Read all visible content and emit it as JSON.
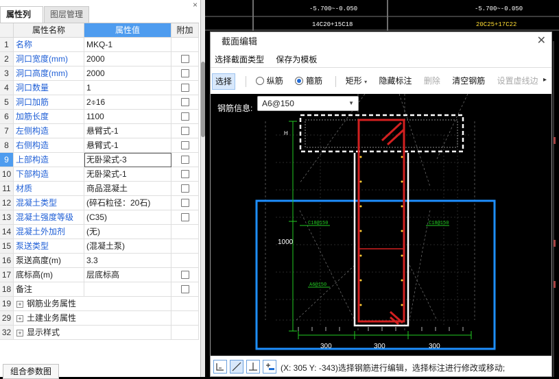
{
  "left_panel": {
    "tabs": [
      "属性列表",
      "图层管理"
    ],
    "close_glyph": "×",
    "headers": [
      "属性名称",
      "属性值",
      "附加"
    ],
    "rows": [
      {
        "num": "1",
        "name": "名称",
        "value": "MKQ-1",
        "name_color": "blue",
        "checkbox": false
      },
      {
        "num": "2",
        "name": "洞口宽度(mm)",
        "value": "2000",
        "name_color": "blue",
        "checkbox": true
      },
      {
        "num": "3",
        "name": "洞口高度(mm)",
        "value": "2000",
        "name_color": "blue",
        "checkbox": true
      },
      {
        "num": "4",
        "name": "洞口数量",
        "value": "1",
        "name_color": "blue",
        "checkbox": true
      },
      {
        "num": "5",
        "name": "洞口加筋",
        "value": "2⌽16",
        "name_color": "blue",
        "checkbox": true
      },
      {
        "num": "6",
        "name": "加筋长度",
        "value": "1100",
        "name_color": "blue",
        "checkbox": true
      },
      {
        "num": "7",
        "name": "左侧构造",
        "value": "悬臂式-1",
        "name_color": "blue",
        "checkbox": true
      },
      {
        "num": "8",
        "name": "右侧构造",
        "value": "悬臂式-1",
        "name_color": "blue",
        "checkbox": true
      },
      {
        "num": "9",
        "name": "上部构造",
        "value": "无卧梁式-3",
        "name_color": "blue",
        "checkbox": true,
        "selected": true
      },
      {
        "num": "10",
        "name": "下部构造",
        "value": "无卧梁式-1",
        "name_color": "blue",
        "checkbox": true
      },
      {
        "num": "11",
        "name": "材质",
        "value": "商品混凝土",
        "name_color": "blue",
        "checkbox": true
      },
      {
        "num": "12",
        "name": "混凝土类型",
        "value": "(碎石粒径：20石)",
        "name_color": "blue",
        "checkbox": true
      },
      {
        "num": "13",
        "name": "混凝土强度等级",
        "value": "(C35)",
        "name_color": "blue",
        "checkbox": true
      },
      {
        "num": "14",
        "name": "混凝土外加剂",
        "value": "(无)",
        "name_color": "blue",
        "checkbox": false
      },
      {
        "num": "15",
        "name": "泵送类型",
        "value": "(混凝土泵)",
        "name_color": "blue",
        "checkbox": false
      },
      {
        "num": "16",
        "name": "泵送高度(m)",
        "value": "3.3",
        "name_color": "black",
        "checkbox": false,
        "value_muted": true
      },
      {
        "num": "17",
        "name": "底标高(m)",
        "value": "层底标高",
        "name_color": "black",
        "checkbox": true
      },
      {
        "num": "18",
        "name": "备注",
        "value": "",
        "name_color": "black",
        "checkbox": true
      }
    ],
    "groups": [
      {
        "num": "19",
        "label": "钢筋业务属性"
      },
      {
        "num": "29",
        "label": "土建业务属性"
      },
      {
        "num": "32",
        "label": "显示样式"
      }
    ],
    "bottom_button": "组合参数图"
  },
  "background": {
    "top_labels": [
      "-5.700~-0.050",
      "-5.700~-0.050",
      "14C20+15C18",
      "20C25+17C22"
    ]
  },
  "dialog": {
    "title": "截面编辑",
    "close_glyph": "✕",
    "menu": [
      "选择截面类型",
      "保存为模板"
    ],
    "tools": {
      "select": "选择",
      "longitudinal": "纵筋",
      "stirrup": "箍筋",
      "shape": "矩形",
      "shape_arrow": "▾",
      "hide_annotation": "隐藏标注",
      "delete": "删除",
      "clear_rebar": "清空钢筋",
      "set_dashed": "设置虚线边",
      "more": "▸"
    },
    "rebar_info_label": "钢筋信息:",
    "rebar_info_value": "A6@150",
    "drawing": {
      "dim_1000": "1000",
      "dim_h": "H",
      "dims_bottom": [
        "300",
        "300",
        "300"
      ],
      "labels": [
        "C18@150",
        "C18@150",
        "A6@150"
      ]
    },
    "status_text": "(X: 305 Y: -343)选择钢筋进行编辑，选择标注进行修改或移动;",
    "status_icons": [
      "corner-snap-icon",
      "line-snap-icon",
      "perpendicular-snap-icon",
      "add-snap-icon"
    ],
    "colors": {
      "accent": "#4e9cef",
      "stirrup": "#d22020",
      "outline": "#ffffff",
      "region": "#1e8fff",
      "dim": "#22cc22"
    }
  }
}
